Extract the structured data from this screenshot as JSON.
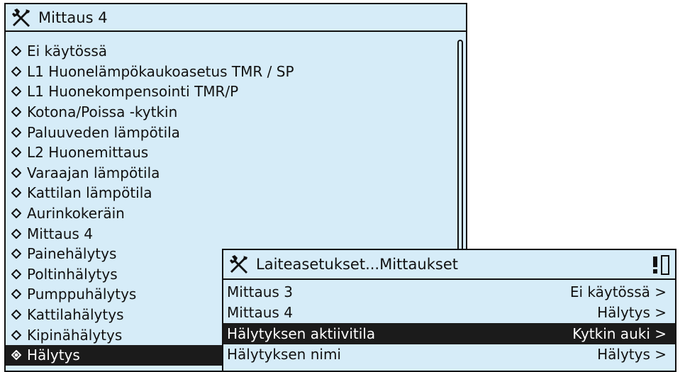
{
  "main_panel": {
    "title": "Mittaus 4",
    "icon": "tools-icon",
    "items": [
      {
        "label": "Ei käytössä",
        "selected": false
      },
      {
        "label": "L1 Huonelämpökaukoasetus TMR / SP",
        "selected": false
      },
      {
        "label": "L1 Huonekompensointi TMR/P",
        "selected": false
      },
      {
        "label": "Kotona/Poissa -kytkin",
        "selected": false
      },
      {
        "label": "Paluuveden lämpötila",
        "selected": false
      },
      {
        "label": "L2 Huonemittaus",
        "selected": false
      },
      {
        "label": "Varaajan lämpötila",
        "selected": false
      },
      {
        "label": "Kattilan lämpötila",
        "selected": false
      },
      {
        "label": "Aurinkokeräin",
        "selected": false
      },
      {
        "label": "Mittaus 4",
        "selected": false
      },
      {
        "label": "Painehälytys",
        "selected": false
      },
      {
        "label": "Poltinhälytys",
        "selected": false
      },
      {
        "label": "Pumppuhälytys",
        "selected": false
      },
      {
        "label": "Kattilahälytys",
        "selected": false
      },
      {
        "label": "Kipinähälytys",
        "selected": false
      },
      {
        "label": "Hälytys",
        "selected": true
      }
    ]
  },
  "popup_panel": {
    "title": "Laiteasetukset...Mittaukset",
    "icon": "tools-icon",
    "alert_icon": "exclamation-icon",
    "rows": [
      {
        "label": "Mittaus 3",
        "value": "Ei käytössä >",
        "selected": false
      },
      {
        "label": "Mittaus 4",
        "value": "Hälytys >",
        "selected": false
      },
      {
        "label": "Hälytyksen aktiivitila",
        "value": "Kytkin auki >",
        "selected": true
      },
      {
        "label": "Hälytyksen nimi",
        "value": "Hälytys >",
        "selected": false
      }
    ]
  },
  "colors": {
    "panel_bg": "#d6ecf8",
    "selected_bg": "#1b1b1b",
    "text": "#111111"
  }
}
